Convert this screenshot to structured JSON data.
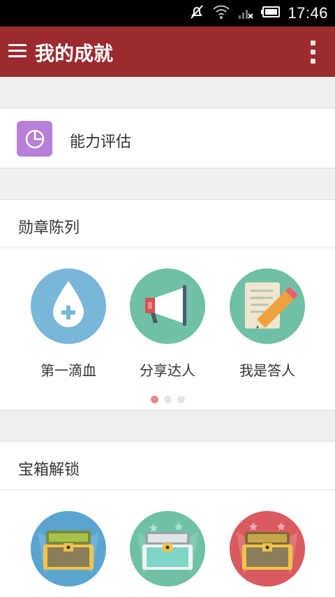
{
  "status_bar": {
    "time": "17:46",
    "icons": [
      "silent-icon",
      "wifi-icon",
      "signal-icon",
      "battery-icon"
    ]
  },
  "app_bar": {
    "title": "我的成就",
    "color": "#9c2a2e"
  },
  "ability": {
    "label": "能力评估",
    "icon": "pie-chart-icon",
    "tile_color": "#b87fd9"
  },
  "medals": {
    "heading": "勋章陈列",
    "items": [
      {
        "label": "第一滴血",
        "icon": "blood-drop-icon",
        "color": "#7ab6da"
      },
      {
        "label": "分享达人",
        "icon": "megaphone-icon",
        "color": "#6fc0a6"
      },
      {
        "label": "我是答人",
        "icon": "notepad-pencil-icon",
        "color": "#6fc0a6"
      }
    ],
    "page_indicator": {
      "count": 3,
      "active": 0,
      "active_color": "#e08a8a"
    }
  },
  "treasure": {
    "heading": "宝箱解锁",
    "items": [
      {
        "icon": "treasure-chest-gold-icon",
        "color": "#5aa5cf"
      },
      {
        "icon": "treasure-chest-silver-icon",
        "color": "#6fc0a6"
      },
      {
        "icon": "treasure-chest-pink-icon",
        "color": "#d95a5f"
      }
    ]
  }
}
